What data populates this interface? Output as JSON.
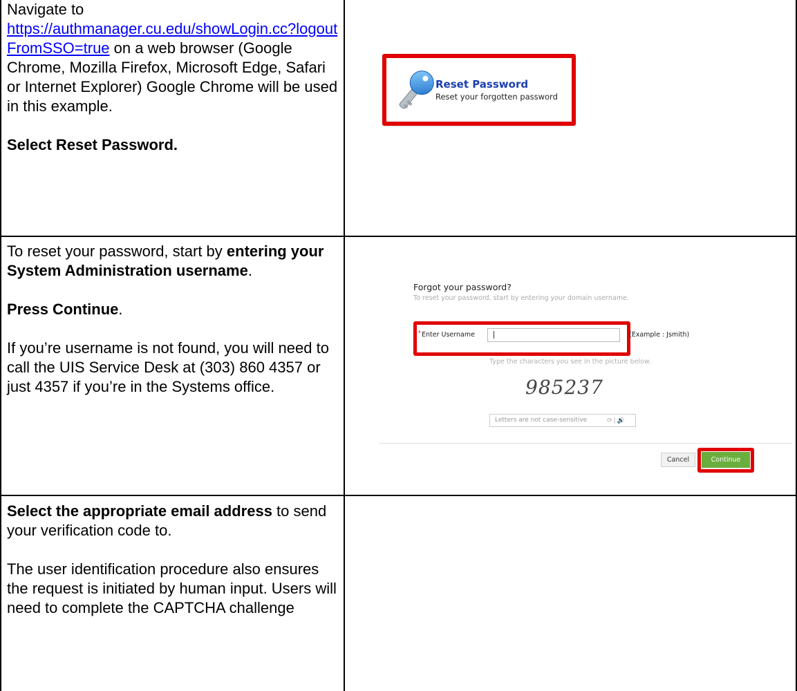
{
  "row1": {
    "text_intro": "Navigate to",
    "link_text": "https://authmanager.cu.edu/showLogin.cc?logoutFromSSO=true",
    "text_after_link": " on a web browser (Google Chrome, Mozilla Firefox, Microsoft Edge, Safari or Internet Explorer) Google Chrome will be used in this example.",
    "instruction": "Select Reset Password.",
    "screenshot": {
      "title": "Reset Password",
      "subtitle": "Reset your forgotten password",
      "icon": "key-icon",
      "highlight_color": "#e00000",
      "title_color": "#1a3fae"
    }
  },
  "row2": {
    "p1_pre": "To reset your password, start by ",
    "p1_bold": "entering your System Administration username",
    "p1_post": ".",
    "p2_bold": "Press Continue",
    "p2_post": ".",
    "p3": "If you’re username is not found, you will need to call the UIS Service Desk at (303) 860 4357 or just 4357 if you’re in the Systems office.",
    "screenshot": {
      "heading": "Forgot your password?",
      "subheading": "To reset your password, start by entering your domain username.",
      "required_marker": "*",
      "username_label": "Enter Username",
      "username_value": "",
      "example": "(Example : Jsmith)",
      "captcha_hint": "Type the characters you see in the picture below.",
      "captcha_text": "985237",
      "captcha_placeholder": "Letters are not case-sensitive",
      "captcha_tools": "⟳ | 🔊",
      "cancel_label": "Cancel",
      "continue_label": "Continue",
      "continue_color": "#6aae3d",
      "highlight_color": "#e00000"
    }
  },
  "row3": {
    "p1_bold": "Select the appropriate email address",
    "p1_post": " to send your verification code to.",
    "p2": "The user identification procedure also ensures the request is initiated by human input.  Users will need to complete the CAPTCHA challenge"
  }
}
